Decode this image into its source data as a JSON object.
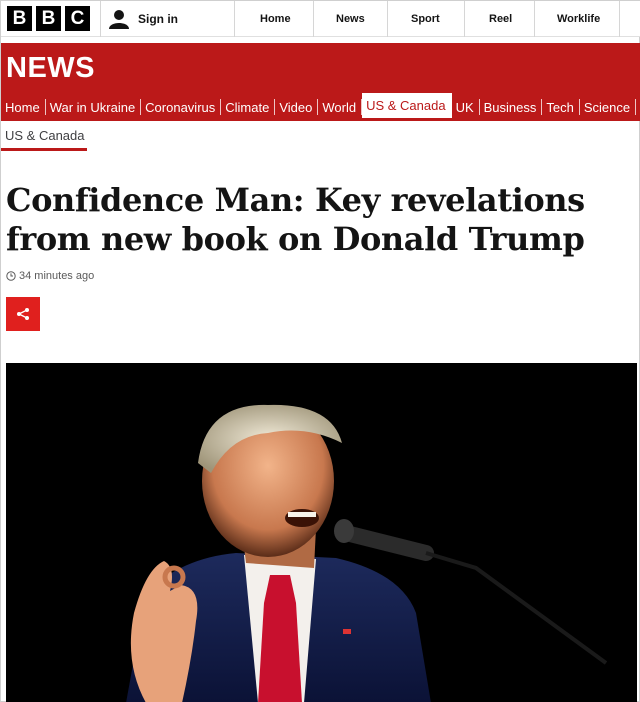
{
  "brand": {
    "letters": [
      "B",
      "B",
      "C"
    ],
    "masthead": "NEWS",
    "accent": "#bb1919"
  },
  "account": {
    "signin_label": "Sign in"
  },
  "global_nav": [
    "Home",
    "News",
    "Sport",
    "Reel",
    "Worklife"
  ],
  "section_nav": {
    "items": [
      "Home",
      "War in Ukraine",
      "Coronavirus",
      "Climate",
      "Video",
      "World",
      "US & Canada",
      "UK",
      "Business",
      "Tech",
      "Science"
    ],
    "active": "US & Canada"
  },
  "breadcrumb": "US & Canada",
  "article": {
    "headline": "Confidence Man: Key revelations from new book on Donald Trump",
    "timestamp": "34 minutes ago",
    "share_icon": "share-icon"
  }
}
